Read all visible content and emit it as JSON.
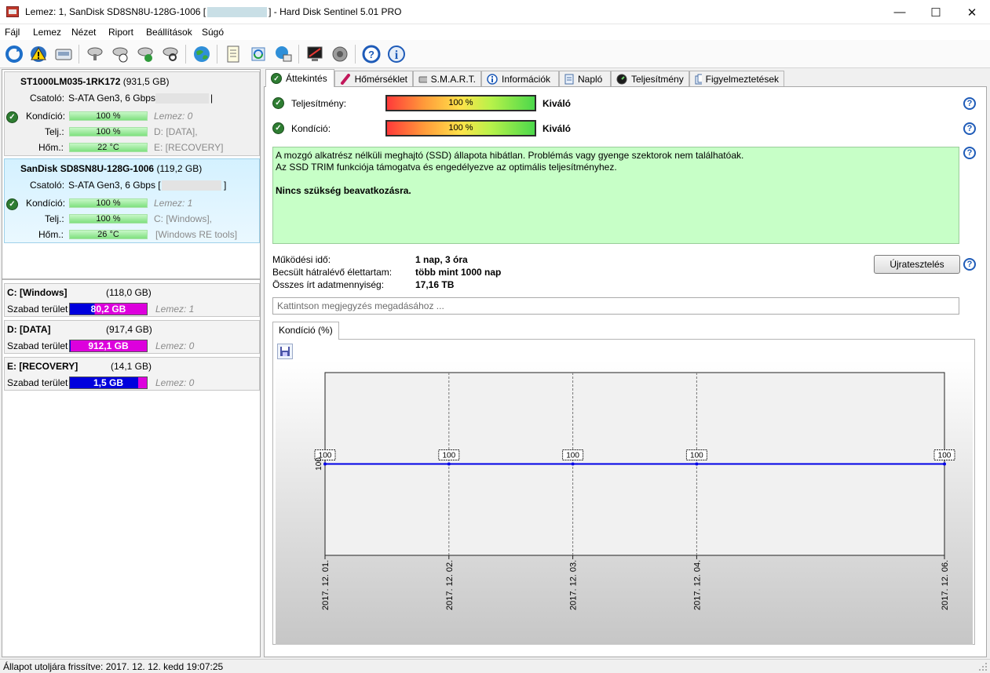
{
  "window": {
    "title_prefix": "Lemez: 1, SanDisk SD8SN8U-128G-1006 [",
    "title_suffix": "]  -  Hard Disk Sentinel 5.01 PRO",
    "minimize": "—",
    "maximize": "☐",
    "close": "✕"
  },
  "menu": [
    "Fájl",
    "Lemez",
    "Nézet",
    "Riport",
    "Beállítások",
    "Súgó"
  ],
  "toolbar": {
    "icons": [
      "refresh-icon",
      "alert-icon",
      "disk-icon",
      "disk-test-icon",
      "disk-test-time-icon",
      "disk-test-ok-icon",
      "disk-search-icon",
      "globe-icon",
      "report-icon",
      "sync-icon",
      "network-icon",
      "monitor-icon",
      "sound-icon",
      "help-icon",
      "info-icon"
    ]
  },
  "disks": [
    {
      "name": "ST1000LM035-1RK172",
      "size": "(931,5 GB)",
      "interface_label": "Csatoló:",
      "interface": "S-ATA Gen3, 6 Gbps",
      "interface_end": "|",
      "health_label": "Kondíció:",
      "health": "100 %",
      "perf_label": "Telj.:",
      "perf": "100 %",
      "temp_label": "Hőm.:",
      "temp": "22 °C",
      "disk_no": "Lemez: 0",
      "partition1": "D: [DATA],",
      "partition2": "E: [RECOVERY]"
    },
    {
      "name": "SanDisk SD8SN8U-128G-1006",
      "size": "(119,2 GB)",
      "interface_label": "Csatoló:",
      "interface": "S-ATA Gen3, 6 Gbps [",
      "interface_end": "]",
      "health_label": "Kondíció:",
      "health": "100 %",
      "perf_label": "Telj.:",
      "perf": "100 %",
      "temp_label": "Hőm.:",
      "temp": "26 °C",
      "disk_no": "Lemez: 1",
      "partition1": "C: [Windows],",
      "partition2": "[Windows RE tools]"
    }
  ],
  "volumes": [
    {
      "name": "C: [Windows]",
      "size": "(118,0 GB)",
      "free_label": "Szabad terület",
      "free": "80,2 GB",
      "free_ratio": 0.68,
      "disk": "Lemez: 1"
    },
    {
      "name": "D: [DATA]",
      "size": "(917,4 GB)",
      "free_label": "Szabad terület",
      "free": "912,1 GB",
      "free_ratio": 0.99,
      "disk": "Lemez: 0"
    },
    {
      "name": "E: [RECOVERY]",
      "size": "(14,1 GB)",
      "free_label": "Szabad terület",
      "free": "1,5 GB",
      "free_ratio": 0.11,
      "disk": "Lemez: 0"
    }
  ],
  "tabs": [
    "Áttekintés",
    "Hőmérséklet",
    "S.M.A.R.T.",
    "Információk",
    "Napló",
    "Teljesítmény",
    "Figyelmeztetések"
  ],
  "overview": {
    "performance_label": "Teljesítmény:",
    "performance": "100 %",
    "performance_status": "Kiváló",
    "health_label": "Kondíció:",
    "health": "100 %",
    "health_status": "Kiváló",
    "message_line1": "A mozgó alkatrész nélküli meghajtó (SSD) állapota hibátlan. Problémás vagy gyenge szektorok nem találhatóak.",
    "message_line2": "Az SSD TRIM funkciója támogatva és engedélyezve az optimális teljesítményhez.",
    "message_line3": "Nincs szükség beavatkozásra.",
    "uptime_label": "Működési idő:",
    "uptime": "1 nap, 3 óra",
    "lifetime_label": "Becsült hátralévő élettartam:",
    "lifetime": "több mint 1000 nap",
    "written_label": "Összes írt adatmennyiség:",
    "written": "17,16 TB",
    "retest_button": "Újratesztelés",
    "comment_placeholder": "Kattintson megjegyzés megadásához ...",
    "help": "?"
  },
  "chart_tab": "Kondíció  (%)",
  "chart_data": {
    "type": "line",
    "x": [
      "2017. 12. 01.",
      "2017. 12. 02.",
      "2017. 12. 03.",
      "2017. 12. 04.",
      "2017. 12. 06."
    ],
    "values": [
      100,
      100,
      100,
      100,
      100
    ],
    "y_tick": "100",
    "line_color": "#0000e6",
    "grid": true
  },
  "status": "Állapot utoljára frissítve: 2017. 12. 12. kedd 19:07:25"
}
